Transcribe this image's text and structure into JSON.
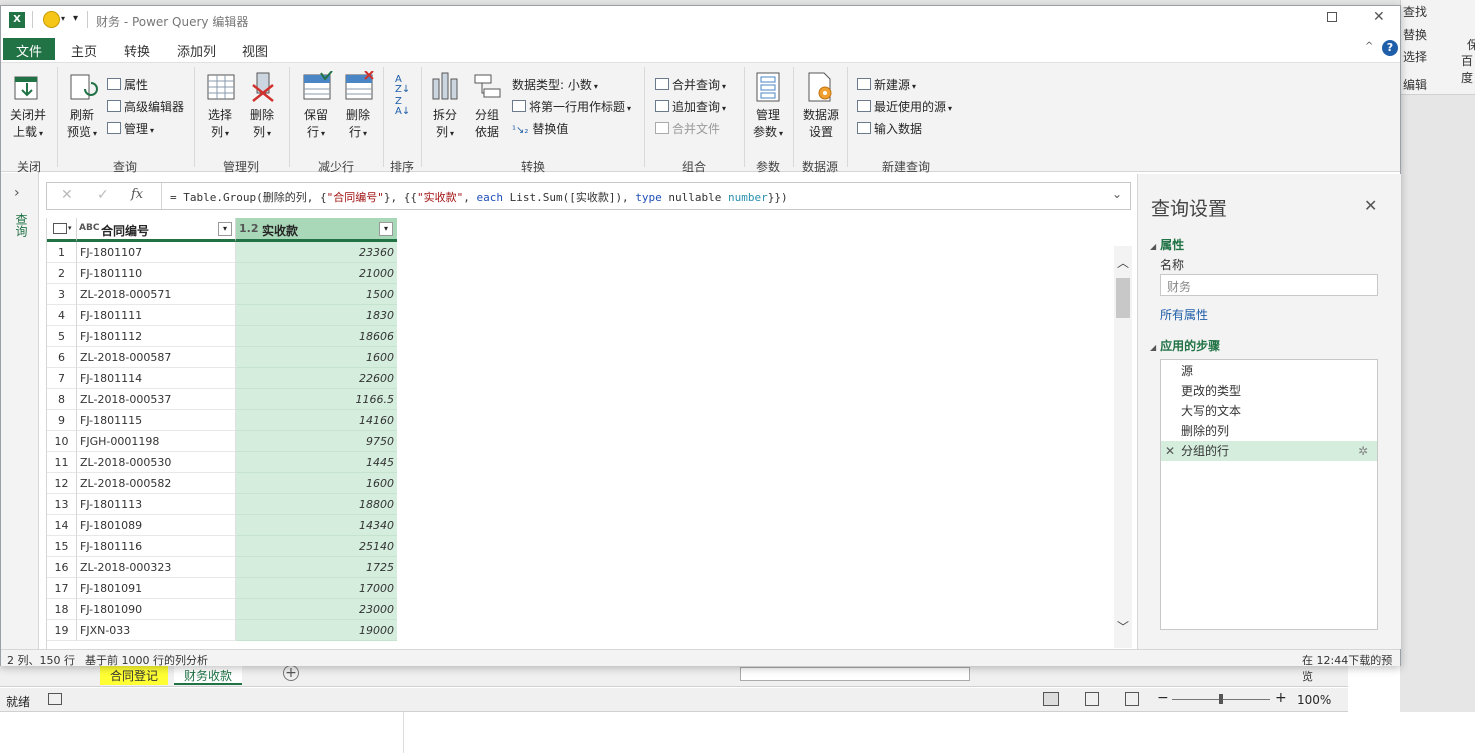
{
  "background_excel": {
    "right_items": [
      "查找",
      "替换",
      "选择",
      "编辑",
      "保",
      "百度"
    ],
    "sheet_tabs": [
      {
        "label": "合同登记"
      },
      {
        "label": "财务收款"
      }
    ],
    "status_ready": "就绪",
    "zoom": "100%"
  },
  "window": {
    "title": "财务 - Power Query 编辑器"
  },
  "menu": {
    "tabs": [
      "文件",
      "主页",
      "转换",
      "添加列",
      "视图"
    ]
  },
  "ribbon": {
    "close_load": "关闭并",
    "close_load2": "上载",
    "refresh": "刷新",
    "refresh2": "预览",
    "properties": "属性",
    "advanced_editor": "高级编辑器",
    "manage": "管理",
    "choose_cols": "选择",
    "choose_cols2": "列",
    "remove_cols": "删除",
    "remove_cols2": "列",
    "keep_rows": "保留",
    "keep_rows2": "行",
    "remove_rows": "删除",
    "remove_rows2": "行",
    "split_col": "拆分",
    "split_col2": "列",
    "group_by": "分组",
    "group_by2": "依据",
    "data_type": "数据类型: 小数",
    "first_row_header": "将第一行用作标题",
    "replace_values": "替换值",
    "merge_queries": "合并查询",
    "append_queries": "追加查询",
    "combine_files": "合并文件",
    "manage_params": "管理",
    "manage_params2": "参数",
    "ds_settings": "数据源",
    "ds_settings2": "设置",
    "new_source": "新建源",
    "recent_sources": "最近使用的源",
    "enter_data": "输入数据",
    "groups": {
      "close": "关闭",
      "query": "查询",
      "manage_cols": "管理列",
      "reduce_rows": "减少行",
      "sort": "排序",
      "transform": "转换",
      "combine": "组合",
      "parameters": "参数",
      "data_sources": "数据源",
      "new_query": "新建查询"
    }
  },
  "leftnav": {
    "label": "查询"
  },
  "formula_bar": {
    "p1": "= Table.Group(删除的列, {",
    "s1": "\"合同编号\"",
    "p2": "}, {{",
    "s2": "\"实收款\"",
    "p3": ", ",
    "k1": "each",
    "p4": " List.Sum([实收款]), ",
    "k2": "type",
    "p5": " nullable ",
    "t1": "number",
    "p6": "}})"
  },
  "grid": {
    "columns": [
      {
        "type_icon": "ABC",
        "name": "合同编号"
      },
      {
        "type_icon": "1.2",
        "name": "实收款"
      }
    ],
    "rows": [
      {
        "n": "1",
        "id": "FJ-1801107",
        "v": "23360"
      },
      {
        "n": "2",
        "id": "FJ-1801110",
        "v": "21000"
      },
      {
        "n": "3",
        "id": "ZL-2018-000571",
        "v": "1500"
      },
      {
        "n": "4",
        "id": "FJ-1801111",
        "v": "1830"
      },
      {
        "n": "5",
        "id": "FJ-1801112",
        "v": "18606"
      },
      {
        "n": "6",
        "id": "ZL-2018-000587",
        "v": "1600"
      },
      {
        "n": "7",
        "id": "FJ-1801114",
        "v": "22600"
      },
      {
        "n": "8",
        "id": "ZL-2018-000537",
        "v": "1166.5"
      },
      {
        "n": "9",
        "id": "FJ-1801115",
        "v": "14160"
      },
      {
        "n": "10",
        "id": "FJGH-0001198",
        "v": "9750"
      },
      {
        "n": "11",
        "id": "ZL-2018-000530",
        "v": "1445"
      },
      {
        "n": "12",
        "id": "ZL-2018-000582",
        "v": "1600"
      },
      {
        "n": "13",
        "id": "FJ-1801113",
        "v": "18800"
      },
      {
        "n": "14",
        "id": "FJ-1801089",
        "v": "14340"
      },
      {
        "n": "15",
        "id": "FJ-1801116",
        "v": "25140"
      },
      {
        "n": "16",
        "id": "ZL-2018-000323",
        "v": "1725"
      },
      {
        "n": "17",
        "id": "FJ-1801091",
        "v": "17000"
      },
      {
        "n": "18",
        "id": "FJ-1801090",
        "v": "23000"
      },
      {
        "n": "19",
        "id": "FJXN-033",
        "v": "19000"
      }
    ]
  },
  "query_settings": {
    "title": "查询设置",
    "properties_section": "属性",
    "name_label": "名称",
    "name_value": "财务",
    "all_properties": "所有属性",
    "applied_steps_section": "应用的步骤",
    "steps": [
      "源",
      "更改的类型",
      "大写的文本",
      "删除的列",
      "分组的行"
    ]
  },
  "status": {
    "left": "2 列、150 行",
    "profile": "基于前 1000 行的列分析",
    "right": "在 12:44下载的预览"
  },
  "colors": {
    "accent": "#217346",
    "selected_col": "#d4eddd",
    "link": "#1f5ea8"
  }
}
